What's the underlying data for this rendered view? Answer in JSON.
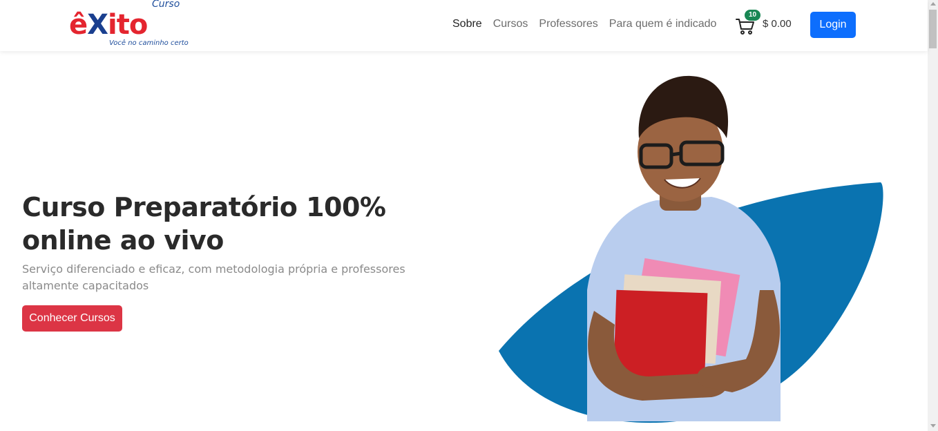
{
  "header": {
    "logo": {
      "small_text": "Curso",
      "brand_prefix": "ê",
      "brand_mid": "X",
      "brand_suffix": "ito",
      "tagline": "Você no caminho certo"
    },
    "nav": [
      {
        "label": "Sobre",
        "active": true
      },
      {
        "label": "Cursos",
        "active": false
      },
      {
        "label": "Professores",
        "active": false
      },
      {
        "label": "Para quem é indicado",
        "active": false
      }
    ],
    "cart": {
      "count": "10",
      "total": "$ 0.00",
      "icon": "cart-icon"
    },
    "login_label": "Login"
  },
  "hero": {
    "title": "Curso Preparatório 100% online ao vivo",
    "subtitle": "Serviço diferenciado e eficaz, com metodologia própria e professores altamente capacitados",
    "cta_label": "Conhecer Cursos"
  },
  "colors": {
    "primary": "#0d6efd",
    "danger": "#dc3545",
    "badge": "#198754",
    "accent_blue": "#0a73b0"
  }
}
